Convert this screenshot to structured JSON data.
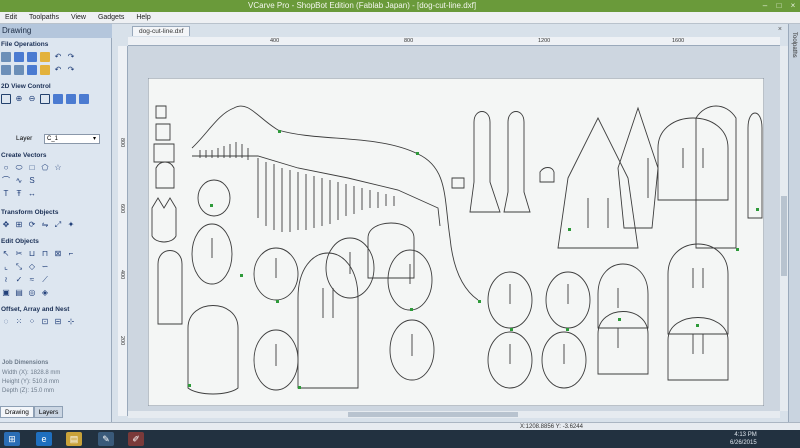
{
  "window": {
    "title": "VCarve Pro - ShopBot Edition (Fablab Japan) - [dog-cut-line.dxf]"
  },
  "menu": [
    "Edit",
    "Toolpaths",
    "View",
    "Gadgets",
    "Help"
  ],
  "left_panel": {
    "title": "Drawing",
    "sections": {
      "file_ops": "File Operations",
      "view_control": "2D View Control",
      "create_vectors": "Create Vectors",
      "transform": "Transform Objects",
      "edit_objects": "Edit Objects",
      "offset": "Offset, Array and Nest"
    },
    "layer_label": "Layer",
    "layer_value": "C_1",
    "dimensions": {
      "heading": "Job Dimensions",
      "width": "Width (X): 1828.8 mm",
      "height": "Height (Y): 510.8 mm",
      "depth": "Depth (Z): 15.0 mm"
    },
    "tabs": [
      "Drawing",
      "Layers"
    ]
  },
  "document": {
    "tab_label": "dog-cut-line.dxf",
    "close_symbol": "×",
    "ruler_top": [
      "400",
      "800",
      "1200",
      "1600"
    ],
    "ruler_left": [
      "800",
      "600",
      "400",
      "200"
    ]
  },
  "right_strip": {
    "label": "Toolpaths"
  },
  "status": {
    "coords": "X:1208.8856 Y: -3.6244"
  },
  "taskbar": {
    "time": "4:13 PM",
    "date": "6/26/2015"
  },
  "colors": {
    "title_bar": "#6a9a3a",
    "sheet": "#f4f6f5",
    "vector_line": "#3d3d3d",
    "node_marker": "#2e9a3a"
  },
  "icons": {
    "start": "windows-start-icon",
    "browser": "internet-explorer-icon",
    "explorer": "file-explorer-icon",
    "tool": "vcarve-app-icon"
  }
}
